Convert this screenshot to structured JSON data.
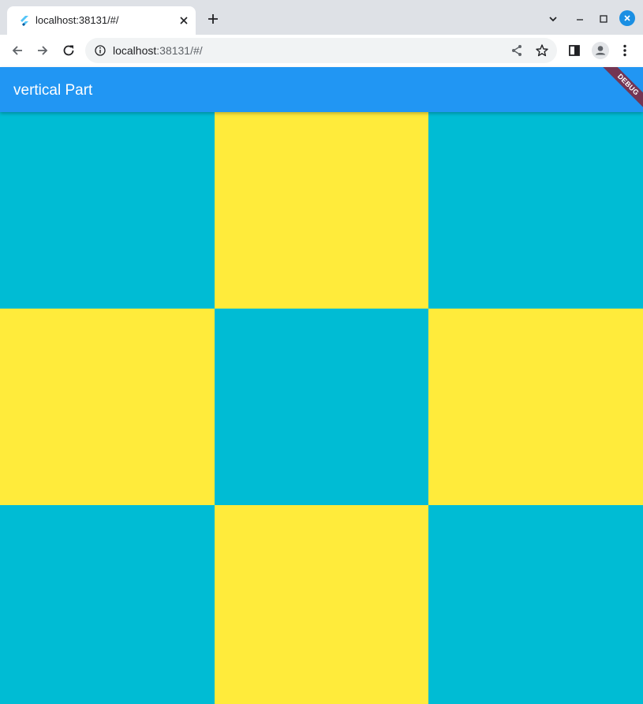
{
  "browser": {
    "tab": {
      "title": "localhost:38131/#/",
      "favicon": "flutter-icon"
    },
    "toolbar": {
      "url_host": "localhost",
      "url_rest": ":38131/#/"
    },
    "window_controls": [
      "tab-search-icon",
      "minimize-icon",
      "maximize-icon",
      "close-icon"
    ]
  },
  "app": {
    "appbar_title": "vertical Part",
    "debug_banner": "DEBUG",
    "colors": {
      "appbar": "#2196f3",
      "cyan": "#00bcd4",
      "yellow": "#ffeb3b"
    },
    "grid": [
      [
        "cyan",
        "yellow",
        "cyan"
      ],
      [
        "yellow",
        "cyan",
        "yellow"
      ],
      [
        "cyan",
        "yellow",
        "cyan"
      ]
    ]
  }
}
